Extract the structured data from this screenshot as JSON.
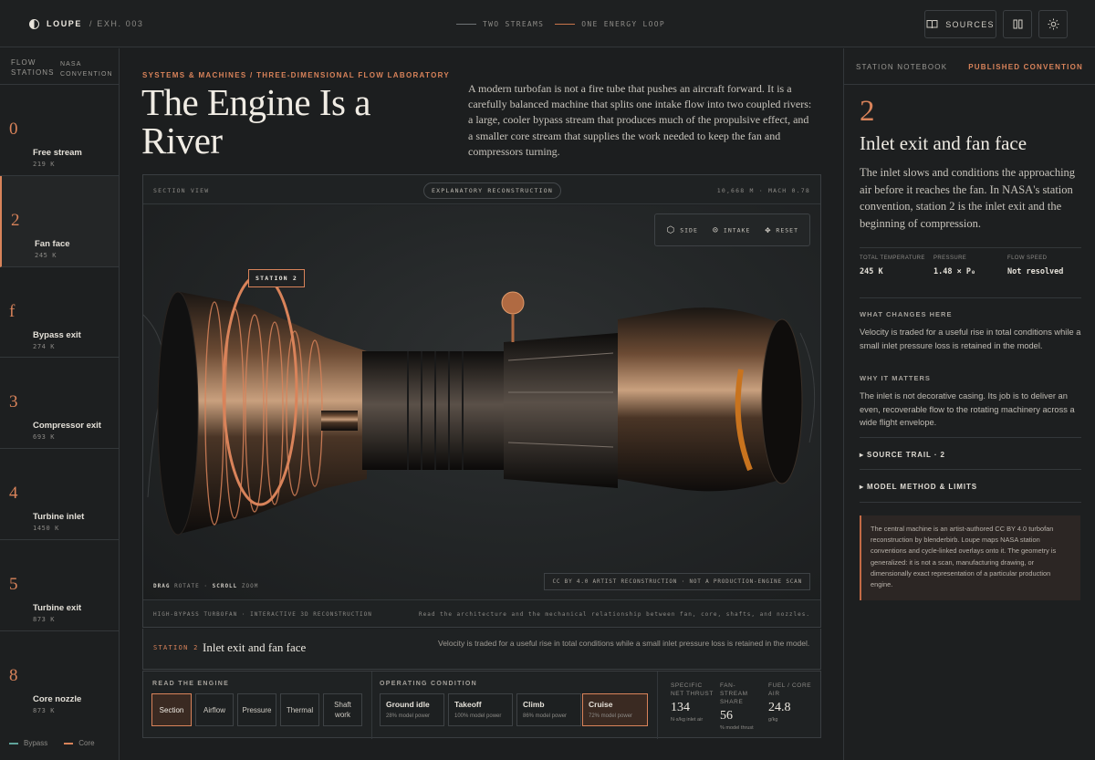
{
  "topbar": {
    "brand": "LOUPE",
    "exhibit": "/ EXH. 003",
    "legend": [
      "TWO STREAMS",
      "ONE ENERGY LOOP"
    ],
    "sources_label": "SOURCES"
  },
  "rail": {
    "head_a": "FLOW STATIONS",
    "head_b": "NASA CONVENTION",
    "stations": [
      {
        "num": "0",
        "name": "Free stream",
        "temp": "219 K"
      },
      {
        "num": "2",
        "name": "Fan face",
        "temp": "245 K"
      },
      {
        "num": "f",
        "name": "Bypass exit",
        "temp": "274 K"
      },
      {
        "num": "3",
        "name": "Compressor exit",
        "temp": "693 K"
      },
      {
        "num": "4",
        "name": "Turbine inlet",
        "temp": "1450 K"
      },
      {
        "num": "5",
        "name": "Turbine exit",
        "temp": "873 K"
      },
      {
        "num": "8",
        "name": "Core nozzle",
        "temp": "873 K"
      }
    ],
    "legend_bypass": "Bypass",
    "legend_core": "Core"
  },
  "header": {
    "kicker": "SYSTEMS & MACHINES / THREE-DIMENSIONAL FLOW LABORATORY",
    "title": "The Engine Is a River",
    "lede": "A modern turbofan is not a fire tube that pushes an aircraft forward. It is a carefully balanced machine that splits one intake flow into two coupled rivers: a large, cooler bypass stream that produces much of the propulsive effect, and a smaller core stream that supplies the work needed to keep the fan and compressors turning."
  },
  "viewer": {
    "section": "SECTION VIEW",
    "badge": "EXPLANATORY RECONSTRUCTION",
    "altitude": "10,668 M · MACH 0.78",
    "ctrl_side": "SIDE",
    "ctrl_intake": "INTAKE",
    "ctrl_reset": "RESET",
    "station_tag": "STATION 2",
    "hint_drag": "DRAG",
    "hint_rotate": "ROTATE",
    "hint_scroll": "SCROLL",
    "hint_zoom": "ZOOM",
    "credit": "CC BY 4.0 ARTIST RECONSTRUCTION · NOT A PRODUCTION-ENGINE SCAN",
    "footer_left": "HIGH-BYPASS TURBOFAN · INTERACTIVE 3D RECONSTRUCTION",
    "footer_right": "Read the architecture and the mechanical relationship between fan, core, shafts, and nozzles."
  },
  "station_bar": {
    "label": "STATION 2",
    "title": "Inlet exit and fan face",
    "desc": "Velocity is traded for a useful rise in total conditions while a small inlet pressure loss is retained in the model."
  },
  "controls": {
    "read_label": "READ THE ENGINE",
    "modes": [
      "Section",
      "Airflow",
      "Pressure",
      "Thermal",
      "Shaft work"
    ],
    "op_label": "OPERATING CONDITION",
    "conditions": [
      {
        "name": "Ground idle",
        "sub": "28% model power"
      },
      {
        "name": "Takeoff",
        "sub": "100% model power"
      },
      {
        "name": "Climb",
        "sub": "86% model power"
      },
      {
        "name": "Cruise",
        "sub": "72% model power"
      }
    ],
    "metrics": [
      {
        "label": "SPECIFIC NET THRUST",
        "value": "134",
        "unit": "N·s/kg inlet air"
      },
      {
        "label": "FAN-STREAM SHARE",
        "value": "56",
        "unit": "% model thrust"
      },
      {
        "label": "FUEL / CORE AIR",
        "value": "24.8",
        "unit": "g/kg"
      }
    ]
  },
  "notebook": {
    "head_left": "STATION NOTEBOOK",
    "head_right": "PUBLISHED CONVENTION",
    "num": "2",
    "title": "Inlet exit and fan face",
    "body": "The inlet slows and conditions the approaching air before it reaches the fan. In NASA's station convention, station 2 is the inlet exit and the beginning of compression.",
    "stats": [
      {
        "label": "TOTAL TEMPERATURE",
        "value": "245 K"
      },
      {
        "label": "PRESSURE",
        "value": "1.48 × P₀"
      },
      {
        "label": "FLOW SPEED",
        "value": "Not resolved"
      }
    ],
    "what_label": "WHAT CHANGES HERE",
    "what_text": "Velocity is traded for a useful rise in total conditions while a small inlet pressure loss is retained in the model.",
    "why_label": "WHY IT MATTERS",
    "why_text": "The inlet is not decorative casing. Its job is to deliver an even, recoverable flow to the rotating machinery across a wide flight envelope.",
    "source_trail": "▸ SOURCE TRAIL · 2",
    "method": "▸ MODEL METHOD & LIMITS",
    "note": "The central machine is an artist-authored CC BY 4.0 turbofan reconstruction by blenderbirb. Loupe maps NASA station conventions and cycle-linked overlays onto it. The geometry is generalized: it is not a scan, manufacturing drawing, or dimensionally exact representation of a particular production engine."
  },
  "colors": {
    "accent": "#d9835a",
    "bypass": "#5fa39a",
    "core": "#d9835a"
  }
}
